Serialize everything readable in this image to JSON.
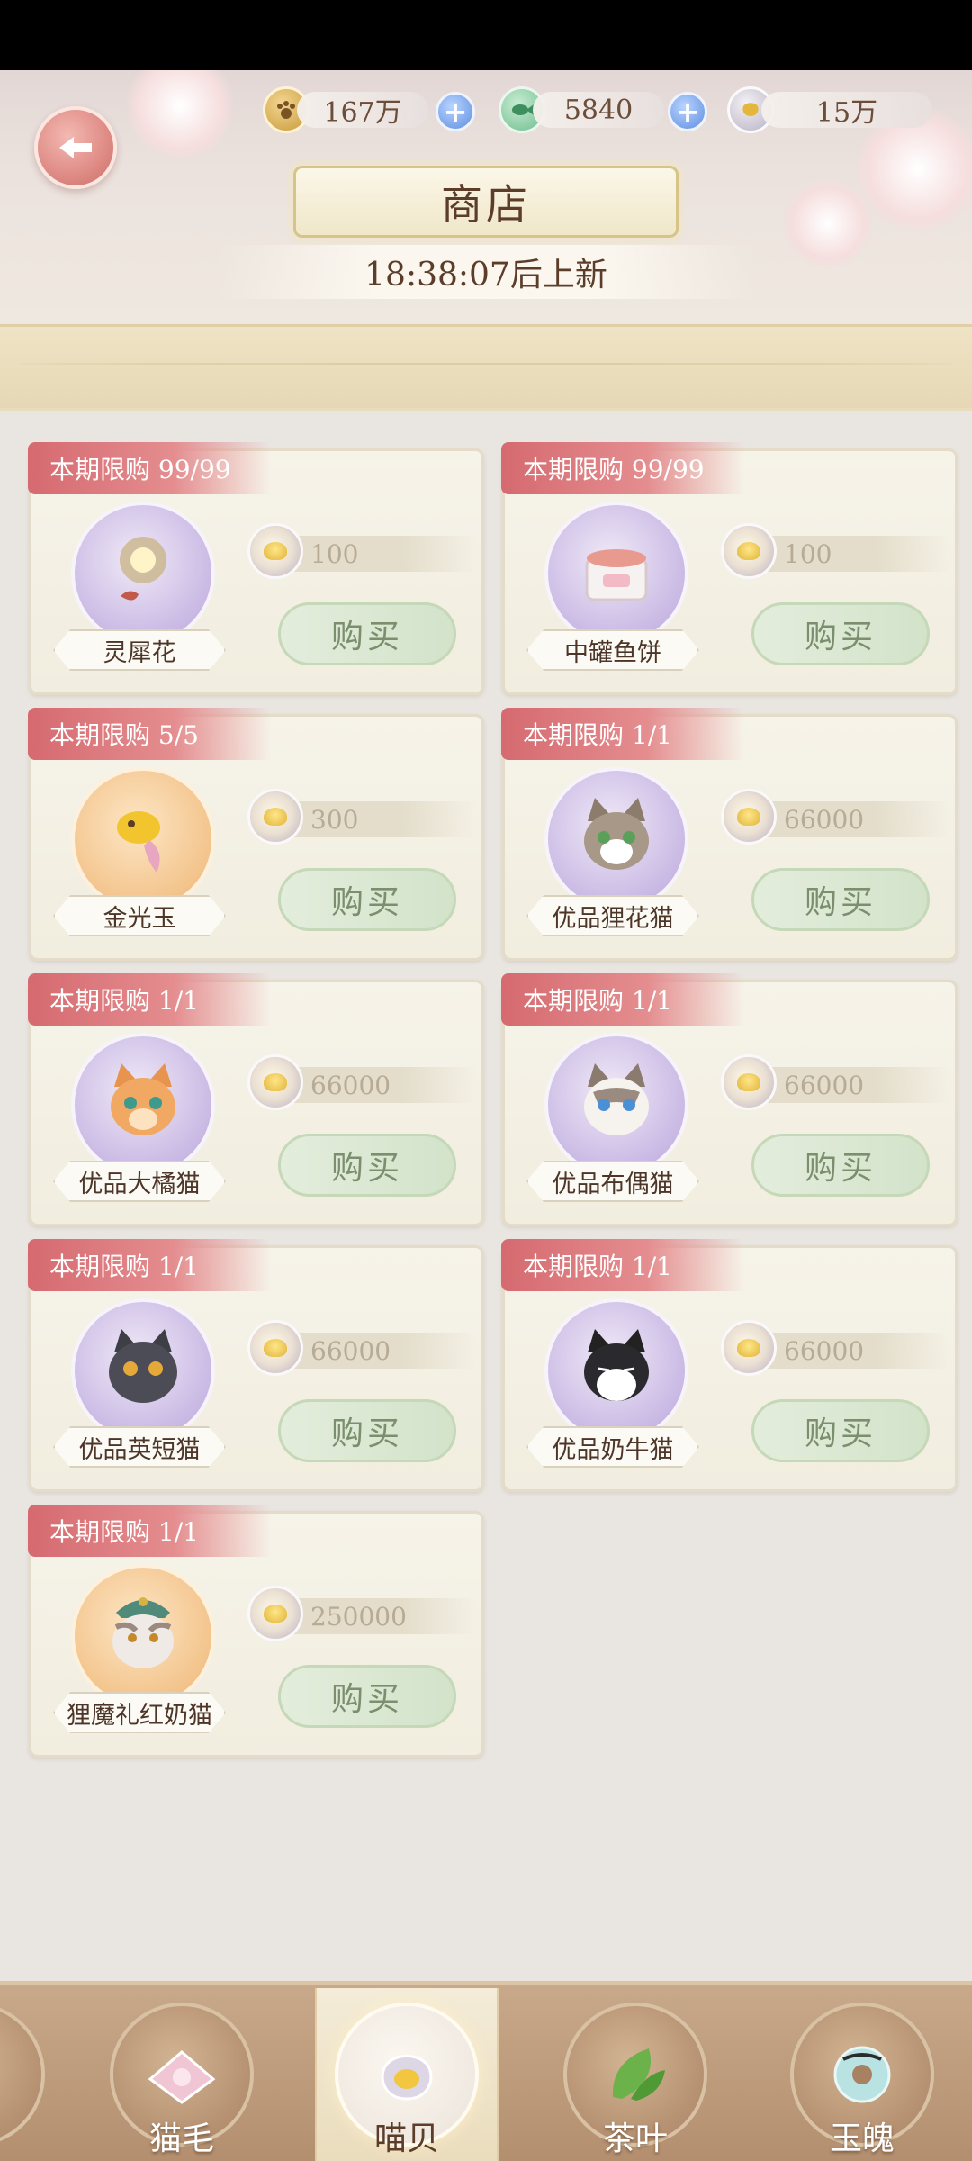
{
  "header": {
    "title": "商店",
    "refresh_text": "18:38:07后上新",
    "currencies": [
      {
        "icon": "paw-coin-icon",
        "value": "167万"
      },
      {
        "icon": "fish-coin-icon",
        "value": "5840"
      },
      {
        "icon": "shell-coin-icon",
        "value": "15万"
      }
    ]
  },
  "items": [
    {
      "limit": "本期限购 99/99",
      "name": "灵犀花",
      "price": "100",
      "buy": "购买",
      "icon": "flower-ornament-icon",
      "bg": "purple"
    },
    {
      "limit": "本期限购 99/99",
      "name": "中罐鱼饼",
      "price": "100",
      "buy": "购买",
      "icon": "fish-can-icon",
      "bg": "purple"
    },
    {
      "limit": "本期限购 5/5",
      "name": "金光玉",
      "price": "300",
      "buy": "购买",
      "icon": "golden-fish-jade-icon",
      "bg": "gold"
    },
    {
      "limit": "本期限购 1/1",
      "name": "优品狸花猫",
      "price": "66000",
      "buy": "购买",
      "icon": "tabby-cat-icon",
      "bg": "purple"
    },
    {
      "limit": "本期限购 1/1",
      "name": "优品大橘猫",
      "price": "66000",
      "buy": "购买",
      "icon": "orange-cat-icon",
      "bg": "purple"
    },
    {
      "limit": "本期限购 1/1",
      "name": "优品布偶猫",
      "price": "66000",
      "buy": "购买",
      "icon": "ragdoll-cat-icon",
      "bg": "purple"
    },
    {
      "limit": "本期限购 1/1",
      "name": "优品英短猫",
      "price": "66000",
      "buy": "购买",
      "icon": "british-shorthair-cat-icon",
      "bg": "purple"
    },
    {
      "limit": "本期限购 1/1",
      "name": "优品奶牛猫",
      "price": "66000",
      "buy": "购买",
      "icon": "tuxedo-cat-icon",
      "bg": "purple"
    },
    {
      "limit": "本期限购 1/1",
      "name": "狸魔礼红奶猫",
      "price": "250000",
      "buy": "购买",
      "icon": "warrior-cat-icon",
      "bg": "gold"
    }
  ],
  "tabs": [
    {
      "label": "猫毛",
      "icon": "cat-fur-icon"
    },
    {
      "label": "喵贝",
      "icon": "shell-icon",
      "active": true
    },
    {
      "label": "茶叶",
      "icon": "tea-leaf-icon"
    },
    {
      "label": "玉魄",
      "icon": "jade-ring-icon"
    }
  ]
}
